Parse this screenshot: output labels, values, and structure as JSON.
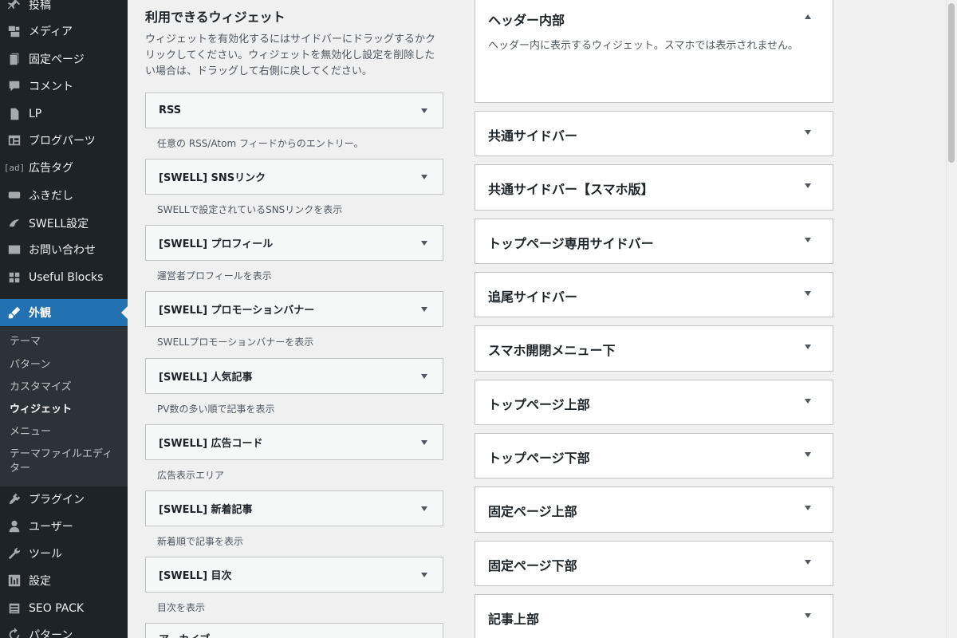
{
  "sidebar": {
    "menu": [
      {
        "label": "投稿",
        "icon": "pin-icon"
      },
      {
        "label": "メディア",
        "icon": "media-icon"
      },
      {
        "label": "固定ページ",
        "icon": "page-icon"
      },
      {
        "label": "コメント",
        "icon": "comment-icon"
      },
      {
        "label": "LP",
        "icon": "document-icon"
      },
      {
        "label": "ブログパーツ",
        "icon": "layout-icon"
      },
      {
        "label": "広告タグ",
        "icon": "ad-icon",
        "icon_text": "[ad]"
      },
      {
        "label": "ふきだし",
        "icon": "bubble-icon"
      },
      {
        "label": "SWELL設定",
        "icon": "swell-icon"
      },
      {
        "label": "お問い合わせ",
        "icon": "mail-icon"
      },
      {
        "label": "Useful Blocks",
        "icon": "blocks-icon"
      },
      {
        "label": "外観",
        "icon": "brush-icon",
        "current": true
      },
      {
        "label": "プラグイン",
        "icon": "plugin-icon"
      },
      {
        "label": "ユーザー",
        "icon": "user-icon"
      },
      {
        "label": "ツール",
        "icon": "wrench-icon"
      },
      {
        "label": "設定",
        "icon": "settings-icon"
      },
      {
        "label": "SEO PACK",
        "icon": "list-icon"
      },
      {
        "label": "パターン",
        "icon": "refresh-icon"
      }
    ],
    "submenu": [
      {
        "label": "テーマ"
      },
      {
        "label": "パターン"
      },
      {
        "label": "カスタマイズ"
      },
      {
        "label": "ウィジェット",
        "active": true
      },
      {
        "label": "メニュー"
      },
      {
        "label": "テーマファイルエディター"
      }
    ]
  },
  "available": {
    "title": "利用できるウィジェット",
    "description": "ウィジェットを有効化するにはサイドバーにドラッグするかクリックしてください。ウィジェットを無効化し設定を削除したい場合は、ドラッグして右側に戻してください。",
    "widgets": [
      {
        "name": "RSS",
        "desc": "任意の RSS/Atom フィードからのエントリー。"
      },
      {
        "name": "[SWELL] SNSリンク",
        "desc": "SWELLで設定されているSNSリンクを表示"
      },
      {
        "name": "[SWELL] プロフィール",
        "desc": "運営者プロフィールを表示"
      },
      {
        "name": "[SWELL] プロモーションバナー",
        "desc": "SWELLプロモーションバナーを表示"
      },
      {
        "name": "[SWELL] 人気記事",
        "desc": "PV数の多い順で記事を表示"
      },
      {
        "name": "[SWELL] 広告コード",
        "desc": "広告表示エリア"
      },
      {
        "name": "[SWELL] 新着記事",
        "desc": "新着順で記事を表示"
      },
      {
        "name": "[SWELL] 目次",
        "desc": "目次を表示"
      },
      {
        "name": "アーカイブ",
        "desc": ""
      }
    ]
  },
  "areas": [
    {
      "name": "ヘッダー内部",
      "desc": "ヘッダー内に表示するウィジェット。スマホでは表示されません。",
      "expanded": true
    },
    {
      "name": "共通サイドバー"
    },
    {
      "name": "共通サイドバー【スマホ版】"
    },
    {
      "name": "トップページ専用サイドバー"
    },
    {
      "name": "追尾サイドバー"
    },
    {
      "name": "スマホ開閉メニュー下"
    },
    {
      "name": "トップページ上部"
    },
    {
      "name": "トップページ下部"
    },
    {
      "name": "固定ページ上部"
    },
    {
      "name": "固定ページ下部"
    },
    {
      "name": "記事上部"
    }
  ],
  "colors": {
    "admin_bar": "#1d2327",
    "accent": "#2271b1",
    "submenu_bg": "#2c3338",
    "page_bg": "#f0f0f1"
  }
}
